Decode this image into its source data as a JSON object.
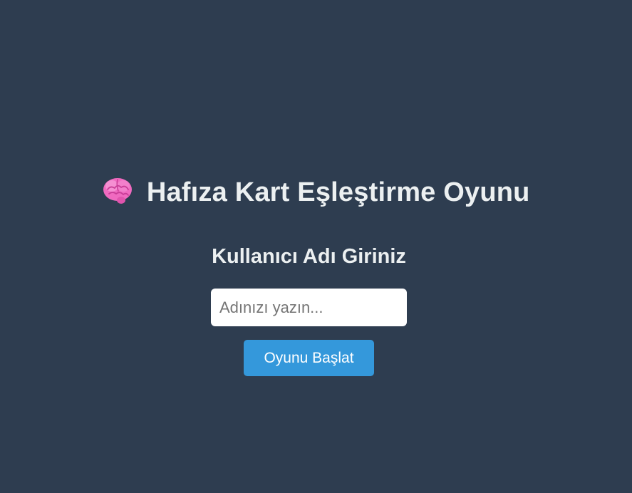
{
  "header": {
    "icon": "brain-icon",
    "title": "Hafıza Kart Eşleştirme Oyunu"
  },
  "login": {
    "heading": "Kullanıcı Adı Giriniz",
    "name_input": {
      "value": "",
      "placeholder": "Adınızı yazın..."
    },
    "start_button_label": "Oyunu Başlat"
  },
  "colors": {
    "background": "#2e3d50",
    "text": "#ecf0f1",
    "button": "#3498db",
    "brain": "#f06ac0"
  }
}
